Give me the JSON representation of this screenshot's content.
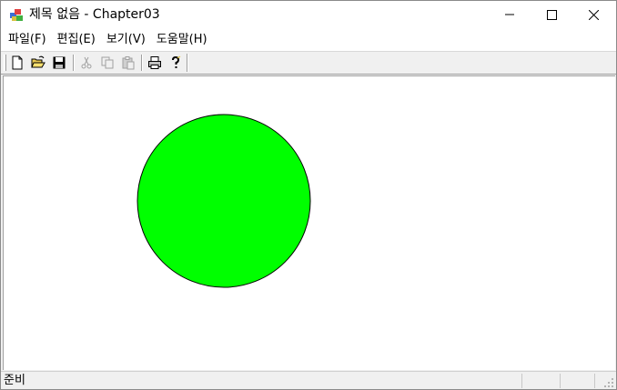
{
  "window": {
    "title": "제목 없음 - Chapter03"
  },
  "menu": {
    "items": [
      {
        "label": "파일(F)"
      },
      {
        "label": "편집(E)"
      },
      {
        "label": "보기(V)"
      },
      {
        "label": "도움말(H)"
      }
    ]
  },
  "toolbar": {
    "buttons": [
      {
        "icon": "new-document-icon",
        "enabled": true
      },
      {
        "icon": "open-folder-icon",
        "enabled": true
      },
      {
        "icon": "save-disk-icon",
        "enabled": true
      },
      {
        "icon": "cut-scissors-icon",
        "enabled": false
      },
      {
        "icon": "copy-icon",
        "enabled": false
      },
      {
        "icon": "paste-icon",
        "enabled": false
      },
      {
        "icon": "print-icon",
        "enabled": true
      },
      {
        "icon": "help-question-icon",
        "enabled": true
      }
    ]
  },
  "canvas": {
    "shape": "circle",
    "fill_color": "#00ff00",
    "stroke_color": "#000000"
  },
  "status": {
    "text": "준비"
  }
}
